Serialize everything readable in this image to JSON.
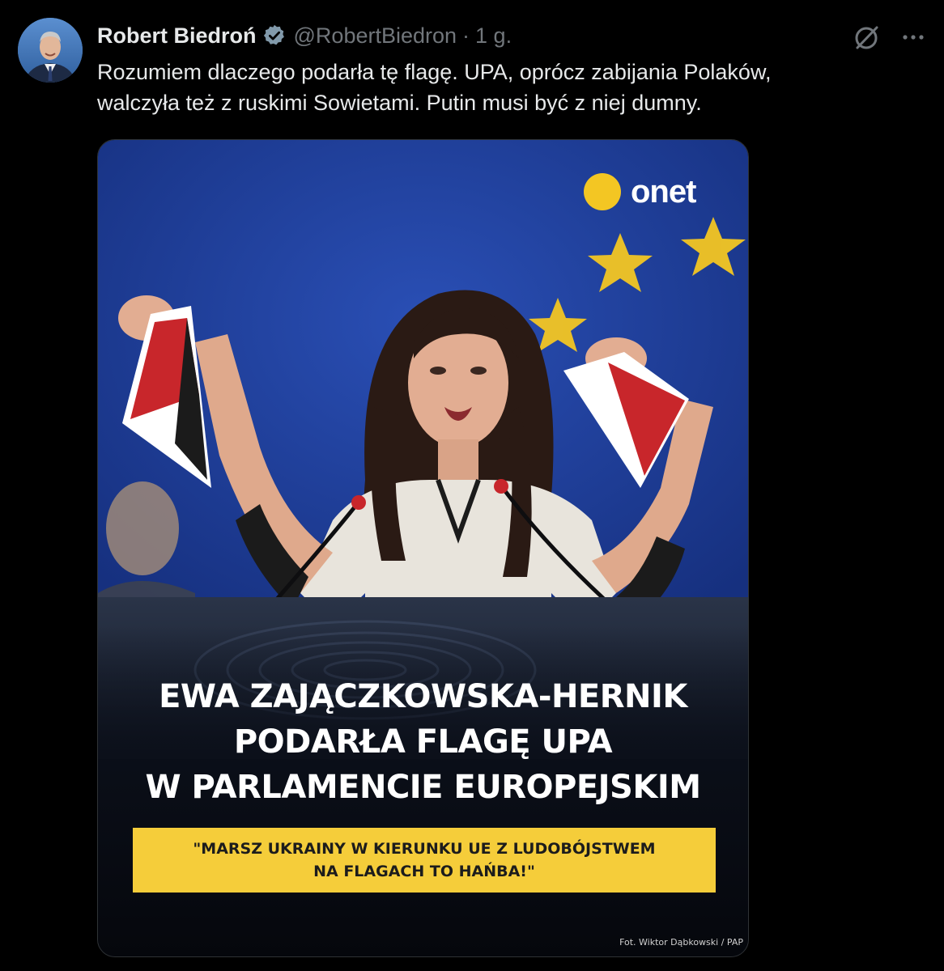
{
  "post": {
    "author_name": "Robert Biedroń",
    "author_handle": "@RobertBiedron",
    "separator": "·",
    "time": "1 g.",
    "text_lines": [
      "Rozumiem dlaczego podarła tę flagę. UPA, oprócz zabijania Polaków,",
      "walczyła też z ruskimi Sowietami. Putin musi być z niej dumny."
    ]
  },
  "icons": {
    "verified": "verified-badge-icon",
    "grok": "grok-icon",
    "more": "more-options-icon"
  },
  "media": {
    "brand": "onet",
    "headline_lines": [
      "EWA ZAJĄCZKOWSKA-HERNIK",
      "PODARŁA FLAGĘ UPA",
      "W PARLAMENCIE EUROPEJSKIM"
    ],
    "quote_lines": [
      "\"MARSZ UKRAINY W KIERUNKU UE Z LUDOBÓJSTWEM",
      "NA FLAGACH TO HAŃBA!\""
    ],
    "credit": "Fot. Wiktor Dąbkowski / PAP"
  },
  "colors": {
    "background": "#000000",
    "text_primary": "#e7e9ea",
    "text_secondary": "#71767b",
    "verified_badge": "#829aab",
    "eu_blue": "#1f3a93",
    "eu_star": "#f3c623",
    "quote_box": "#f5cd3a",
    "flag_red": "#c8262b"
  }
}
